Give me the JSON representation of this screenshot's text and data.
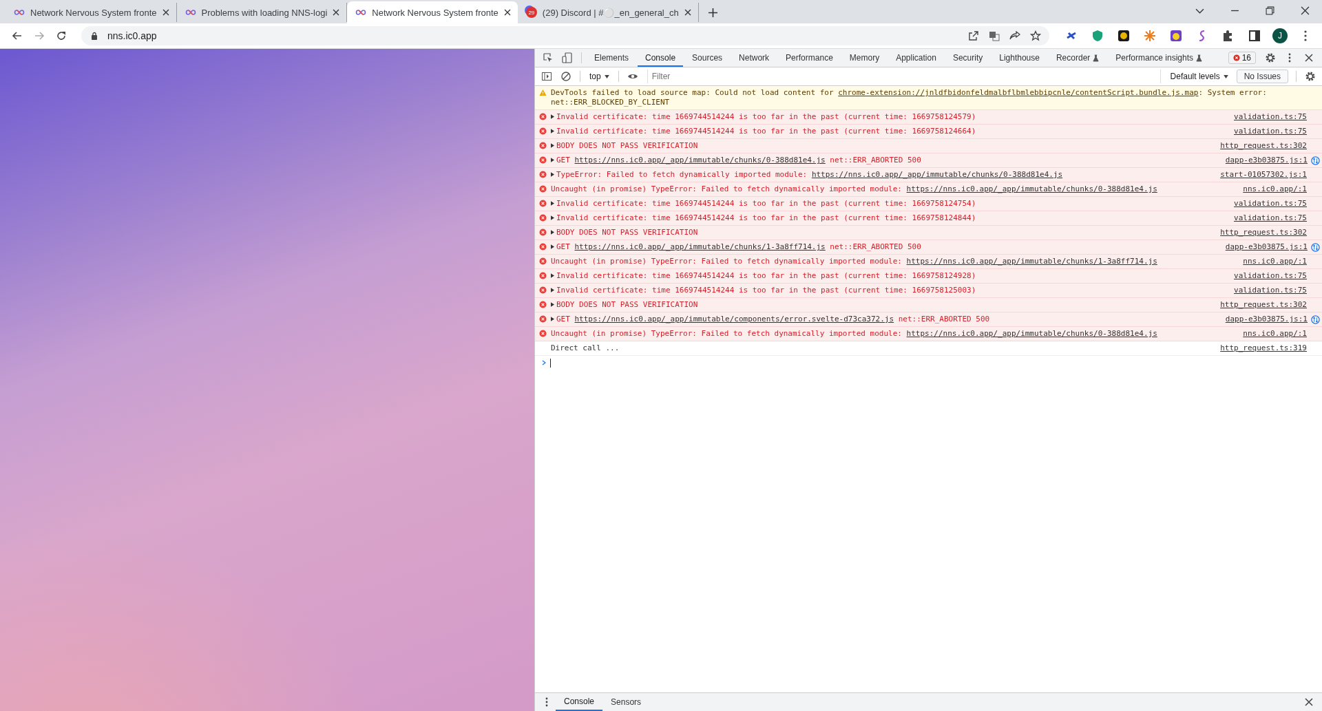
{
  "browser": {
    "tabs": [
      {
        "title": "Network Nervous System fronte",
        "selected": false,
        "kind": "infinity"
      },
      {
        "title": "Problems with loading NNS-logi",
        "selected": false,
        "kind": "infinity"
      },
      {
        "title": "Network Nervous System fronte",
        "selected": true,
        "kind": "infinity"
      },
      {
        "title": "(29) Discord | #⚪_en_general_ch",
        "selected": false,
        "kind": "discord",
        "badge": "29"
      }
    ],
    "address": "nns.ic0.app",
    "profile_initial": "J"
  },
  "devtools": {
    "tabs": [
      {
        "label": "Elements",
        "selected": false,
        "experimental": false
      },
      {
        "label": "Console",
        "selected": true,
        "experimental": false
      },
      {
        "label": "Sources",
        "selected": false,
        "experimental": false
      },
      {
        "label": "Network",
        "selected": false,
        "experimental": false
      },
      {
        "label": "Performance",
        "selected": false,
        "experimental": false
      },
      {
        "label": "Memory",
        "selected": false,
        "experimental": false
      },
      {
        "label": "Application",
        "selected": false,
        "experimental": false
      },
      {
        "label": "Security",
        "selected": false,
        "experimental": false
      },
      {
        "label": "Lighthouse",
        "selected": false,
        "experimental": false
      },
      {
        "label": "Recorder",
        "selected": false,
        "experimental": true
      },
      {
        "label": "Performance insights",
        "selected": false,
        "experimental": true
      }
    ],
    "error_count": "16",
    "context": "top",
    "filter": {
      "placeholder": "Filter"
    },
    "levels": "Default levels",
    "issues": "No Issues",
    "messages": [
      {
        "kind": "warning",
        "expandable": false,
        "network": false,
        "parts": [
          {
            "text": "DevTools failed to load source map: Could not load content for ",
            "link": false
          },
          {
            "text": "chrome-extension://jnldfbidonfeldmalbflbmlebbipcnle/contentScript.bundle.js.map",
            "link": true
          },
          {
            "text": ": System error: net::ERR_BLOCKED_BY_CLIENT",
            "link": false
          }
        ]
      },
      {
        "kind": "error",
        "expandable": true,
        "network": false,
        "parts": [
          {
            "text": "Invalid certificate: time 1669744514244 is too far in the past (current time: 1669758124579)",
            "link": false
          }
        ],
        "source": "validation.ts:75"
      },
      {
        "kind": "error",
        "expandable": true,
        "network": false,
        "parts": [
          {
            "text": "Invalid certificate: time 1669744514244 is too far in the past (current time: 1669758124664)",
            "link": false
          }
        ],
        "source": "validation.ts:75"
      },
      {
        "kind": "error",
        "expandable": true,
        "network": false,
        "parts": [
          {
            "text": "BODY DOES NOT PASS VERIFICATION",
            "link": false
          }
        ],
        "source": "http_request.ts:302"
      },
      {
        "kind": "error",
        "expandable": true,
        "network": true,
        "parts": [
          {
            "text": "GET ",
            "link": false
          },
          {
            "text": "https://nns.ic0.app/_app/immutable/chunks/0-388d81e4.js",
            "link": true
          },
          {
            "text": " net::ERR_ABORTED 500",
            "link": false
          }
        ],
        "source": "dapp-e3b03875.js:1"
      },
      {
        "kind": "error",
        "expandable": true,
        "network": false,
        "parts": [
          {
            "text": "TypeError: Failed to fetch dynamically imported module: ",
            "link": false
          },
          {
            "text": "https://nns.ic0.app/_app/immutable/chunks/0-388d81e4.js",
            "link": true
          }
        ],
        "source": "start-01057302.js:1"
      },
      {
        "kind": "error",
        "expandable": false,
        "network": false,
        "parts": [
          {
            "text": "Uncaught (in promise) TypeError: Failed to fetch dynamically imported module: ",
            "link": false
          },
          {
            "text": "https://nns.ic0.app/_app/immutable/chunks/0-388d81e4.js",
            "link": true
          }
        ],
        "source": "nns.ic0.app/:1"
      },
      {
        "kind": "error",
        "expandable": true,
        "network": false,
        "parts": [
          {
            "text": "Invalid certificate: time 1669744514244 is too far in the past (current time: 1669758124754)",
            "link": false
          }
        ],
        "source": "validation.ts:75"
      },
      {
        "kind": "error",
        "expandable": true,
        "network": false,
        "parts": [
          {
            "text": "Invalid certificate: time 1669744514244 is too far in the past (current time: 1669758124844)",
            "link": false
          }
        ],
        "source": "validation.ts:75"
      },
      {
        "kind": "error",
        "expandable": true,
        "network": false,
        "parts": [
          {
            "text": "BODY DOES NOT PASS VERIFICATION",
            "link": false
          }
        ],
        "source": "http_request.ts:302"
      },
      {
        "kind": "error",
        "expandable": true,
        "network": true,
        "parts": [
          {
            "text": "GET ",
            "link": false
          },
          {
            "text": "https://nns.ic0.app/_app/immutable/chunks/1-3a8ff714.js",
            "link": true
          },
          {
            "text": " net::ERR_ABORTED 500",
            "link": false
          }
        ],
        "source": "dapp-e3b03875.js:1"
      },
      {
        "kind": "error",
        "expandable": false,
        "network": false,
        "parts": [
          {
            "text": "Uncaught (in promise) TypeError: Failed to fetch dynamically imported module: ",
            "link": false
          },
          {
            "text": "https://nns.ic0.app/_app/immutable/chunks/1-3a8ff714.js",
            "link": true
          }
        ],
        "source": "nns.ic0.app/:1"
      },
      {
        "kind": "error",
        "expandable": true,
        "network": false,
        "parts": [
          {
            "text": "Invalid certificate: time 1669744514244 is too far in the past (current time: 1669758124928)",
            "link": false
          }
        ],
        "source": "validation.ts:75"
      },
      {
        "kind": "error",
        "expandable": true,
        "network": false,
        "parts": [
          {
            "text": "Invalid certificate: time 1669744514244 is too far in the past (current time: 1669758125003)",
            "link": false
          }
        ],
        "source": "validation.ts:75"
      },
      {
        "kind": "error",
        "expandable": true,
        "network": false,
        "parts": [
          {
            "text": "BODY DOES NOT PASS VERIFICATION",
            "link": false
          }
        ],
        "source": "http_request.ts:302"
      },
      {
        "kind": "error",
        "expandable": true,
        "network": true,
        "parts": [
          {
            "text": "GET ",
            "link": false
          },
          {
            "text": "https://nns.ic0.app/_app/immutable/components/error.svelte-d73ca372.js",
            "link": true
          },
          {
            "text": " net::ERR_ABORTED 500",
            "link": false
          }
        ],
        "source": "dapp-e3b03875.js:1"
      },
      {
        "kind": "error",
        "expandable": false,
        "network": false,
        "parts": [
          {
            "text": "Uncaught (in promise) TypeError: Failed to fetch dynamically imported module: ",
            "link": false
          },
          {
            "text": "https://nns.ic0.app/_app/immutable/chunks/0-388d81e4.js",
            "link": true
          }
        ],
        "source": "nns.ic0.app/:1"
      },
      {
        "kind": "log",
        "expandable": false,
        "network": false,
        "parts": [
          {
            "text": "Direct call ...",
            "link": false
          }
        ],
        "source": "http_request.ts:319"
      }
    ],
    "drawer_tabs": [
      {
        "label": "Console",
        "selected": true
      },
      {
        "label": "Sensors",
        "selected": false
      }
    ]
  }
}
